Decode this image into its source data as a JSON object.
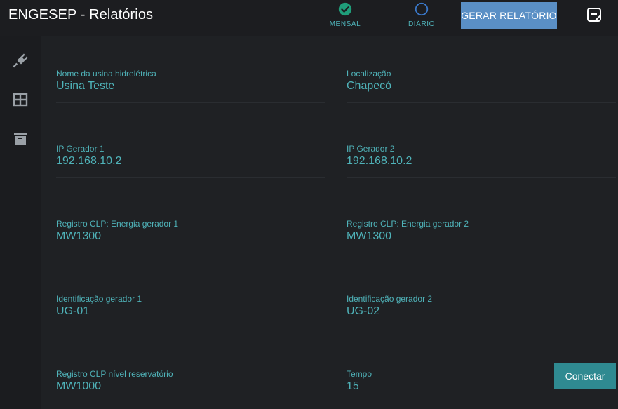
{
  "app": {
    "title": "ENGESEP - Relatórios"
  },
  "header": {
    "modes": [
      {
        "label": "MENSAL",
        "selected": true,
        "icon": "check-circle-icon"
      },
      {
        "label": "DIÁRIO",
        "selected": false,
        "icon": "radio-empty-icon"
      }
    ],
    "generate_label": "GERAR RELATÓRIO",
    "note_icon": "note-icon"
  },
  "sidebar": {
    "items": [
      {
        "icon": "plug-icon"
      },
      {
        "icon": "table-icon"
      },
      {
        "icon": "archive-icon"
      }
    ]
  },
  "form": {
    "usina": {
      "label": "Nome da usina hidrelétrica",
      "value": "Usina Teste"
    },
    "localizacao": {
      "label": "Localização",
      "value": "Chapecó"
    },
    "ip1": {
      "label": "IP Gerador 1",
      "value": "192.168.10.2"
    },
    "ip2": {
      "label": "IP Gerador 2",
      "value": "192.168.10.2"
    },
    "reg1": {
      "label": "Registro CLP: Energia gerador 1",
      "value": "MW1300"
    },
    "reg2": {
      "label": "Registro CLP: Energia gerador 2",
      "value": "MW1300"
    },
    "id1": {
      "label": "Identificação gerador 1",
      "value": "UG-01"
    },
    "id2": {
      "label": "Identificação gerador 2",
      "value": "UG-02"
    },
    "reservatorio": {
      "label": "Registro CLP nível reservatório",
      "value": "MW1000"
    },
    "tempo": {
      "label": "Tempo",
      "value": "15"
    }
  },
  "actions": {
    "connect_label": "Conectar"
  },
  "colors": {
    "accent": "#4fb3b9",
    "generate_button": "#5a8fc5",
    "connect_button": "#2f8a91",
    "selected_check": "#1f9e7a",
    "radio_outline": "#3a78c9"
  }
}
